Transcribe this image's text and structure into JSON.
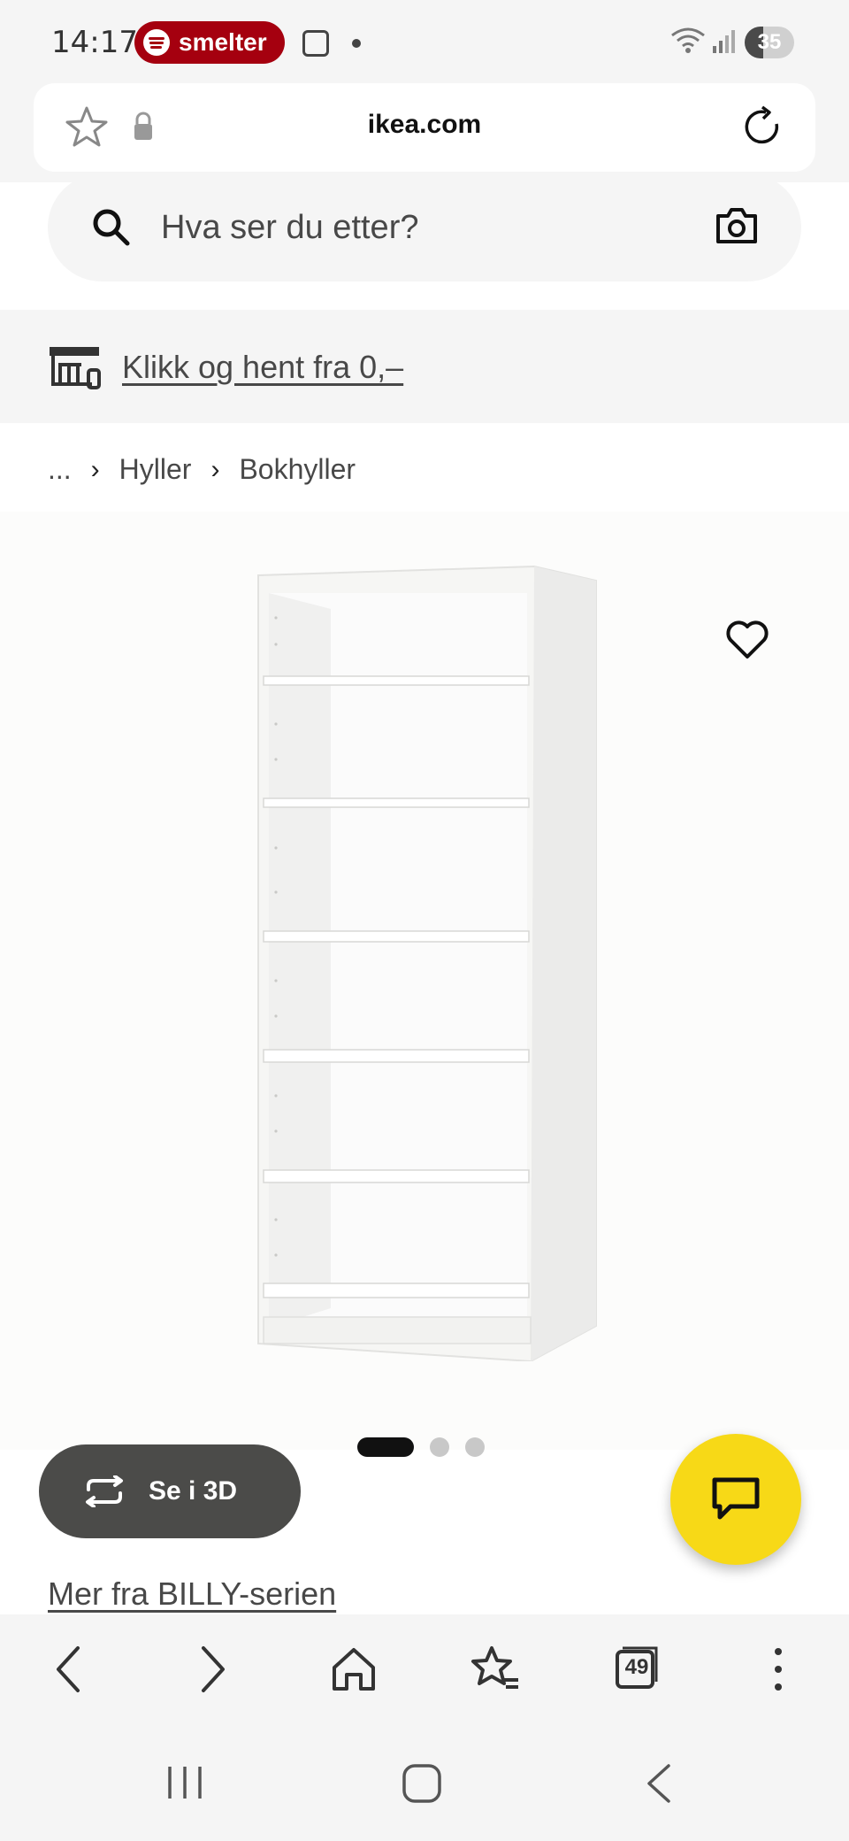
{
  "status_bar": {
    "time": "14:17",
    "media_pill": "smelter",
    "battery": "35"
  },
  "browser": {
    "url": "ikea.com"
  },
  "search": {
    "placeholder": "Hva ser du etter?"
  },
  "banner": {
    "text": "Klikk og hent fra 0,–"
  },
  "breadcrumb": {
    "ellipsis": "...",
    "items": [
      "Hyller",
      "Bokhyller"
    ]
  },
  "product": {
    "view_3d_label": "Se i 3D",
    "image_count": 3,
    "active_image": 1
  },
  "series_link": "Mer fra BILLY-serien",
  "toolbar": {
    "tab_count": "49"
  },
  "colors": {
    "ikea_yellow": "#f7d917",
    "spotify_pill": "#a5000f",
    "dark_button": "#4b4b49"
  }
}
